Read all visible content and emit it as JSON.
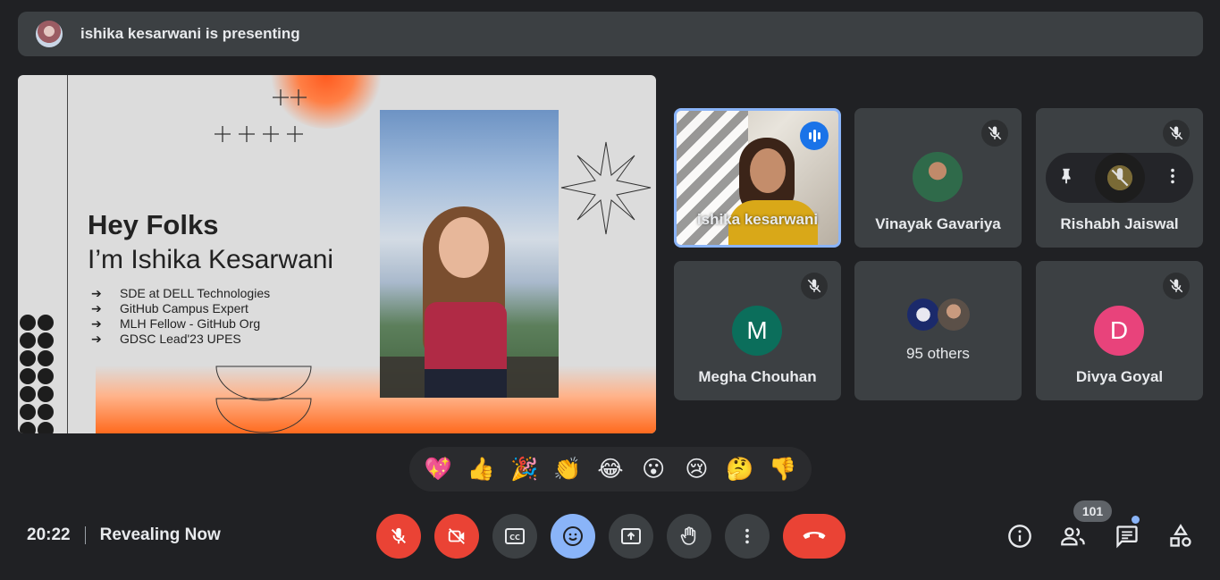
{
  "banner": {
    "text": "ishika kesarwani is presenting",
    "avatar_icon": "presenter-avatar"
  },
  "slide": {
    "title_line1": "Hey Folks",
    "title_line2": "I’m Ishika Kesarwani",
    "bullets": [
      {
        "arrow": "➔",
        "text": "SDE at DELL Technologies"
      },
      {
        "arrow": "➔",
        "text": "GitHub Campus Expert"
      },
      {
        "arrow": "➔",
        "text": "MLH Fellow - GitHub Org"
      },
      {
        "arrow": "➔",
        "text": "GDSC Lead'23 UPES"
      }
    ]
  },
  "participants": [
    {
      "name": "ishika kesarwani",
      "state": "speaking"
    },
    {
      "name": "Vinayak Gavariya",
      "state": "muted"
    },
    {
      "name": "Rishabh Jaiswal",
      "state": "muted"
    },
    {
      "name": "Megha Chouhan",
      "state": "muted",
      "initial": "M",
      "color": "#0b6e5b"
    },
    {
      "name": "95 others",
      "state": "group"
    },
    {
      "name": "Divya Goyal",
      "state": "muted",
      "initial": "D",
      "color": "#e8437b"
    }
  ],
  "reactions": [
    "💖",
    "👍",
    "🎉",
    "👏",
    "😂",
    "😮",
    "😢",
    "🤔",
    "👎"
  ],
  "footer": {
    "time": "20:22",
    "meeting_name": "Revealing Now",
    "participant_count": "101"
  },
  "colors": {
    "background": "#202124",
    "tile": "#3c4043",
    "danger": "#ea4335",
    "accent": "#8ab4f8"
  }
}
